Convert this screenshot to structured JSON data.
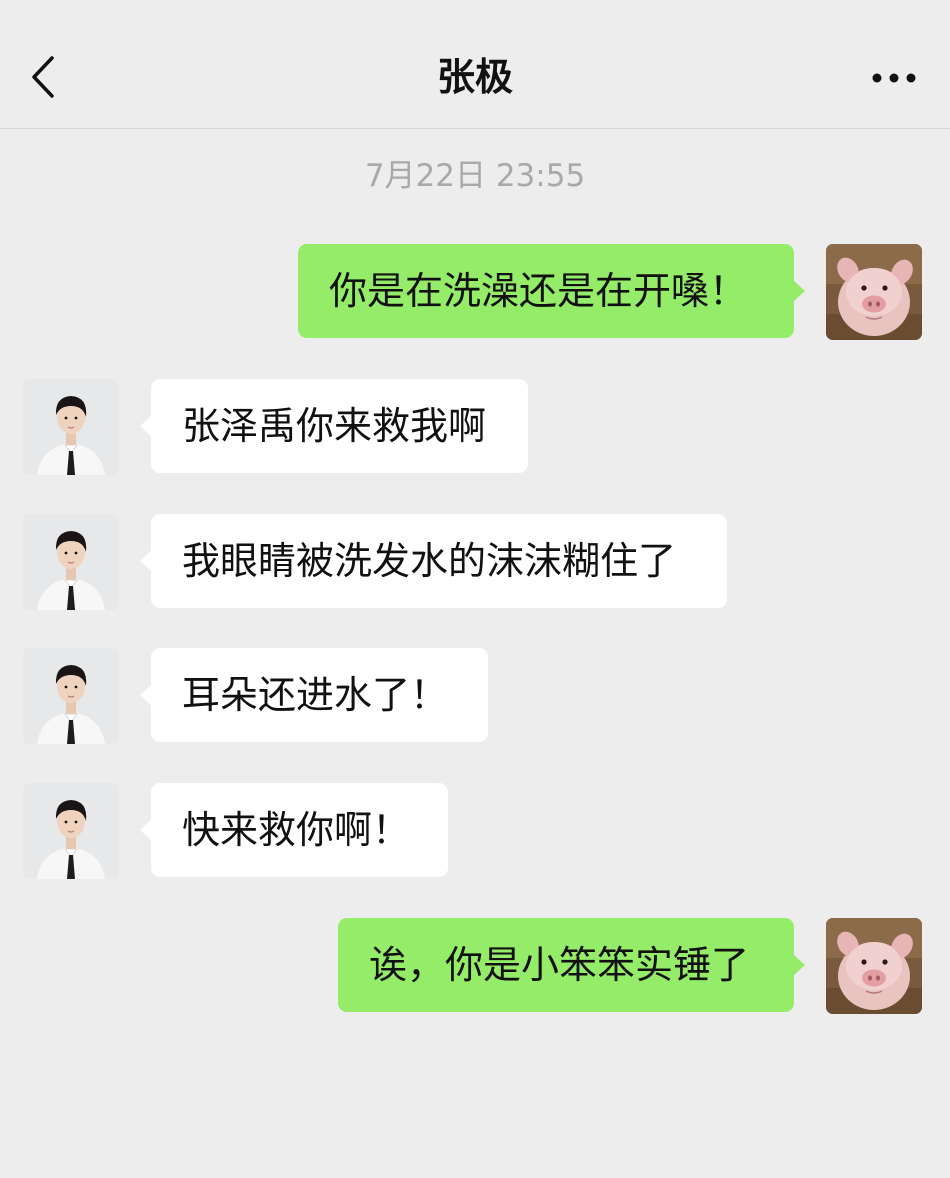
{
  "header": {
    "title": "张极",
    "back_icon": "chevron-left-icon",
    "more_icon": "more-dots-icon"
  },
  "chat": {
    "timestamp": "7月22日 23:55",
    "messages": [
      {
        "side": "right",
        "sender": "self",
        "text": "你是在洗澡还是在开嗓！"
      },
      {
        "side": "left",
        "sender": "contact",
        "text": "张泽禹你来救我啊"
      },
      {
        "side": "left",
        "sender": "contact",
        "text": "我眼睛被洗发水的沫沫糊住了"
      },
      {
        "side": "left",
        "sender": "contact",
        "text": "耳朵还进水了！"
      },
      {
        "side": "left",
        "sender": "contact",
        "text": "快来救你啊！"
      },
      {
        "side": "right",
        "sender": "self",
        "text": "诶，你是小笨笨实锤了"
      }
    ]
  },
  "colors": {
    "background": "#ededed",
    "outgoing_bubble": "#95ec69",
    "incoming_bubble": "#ffffff",
    "timestamp_text": "#a9a9a9"
  }
}
